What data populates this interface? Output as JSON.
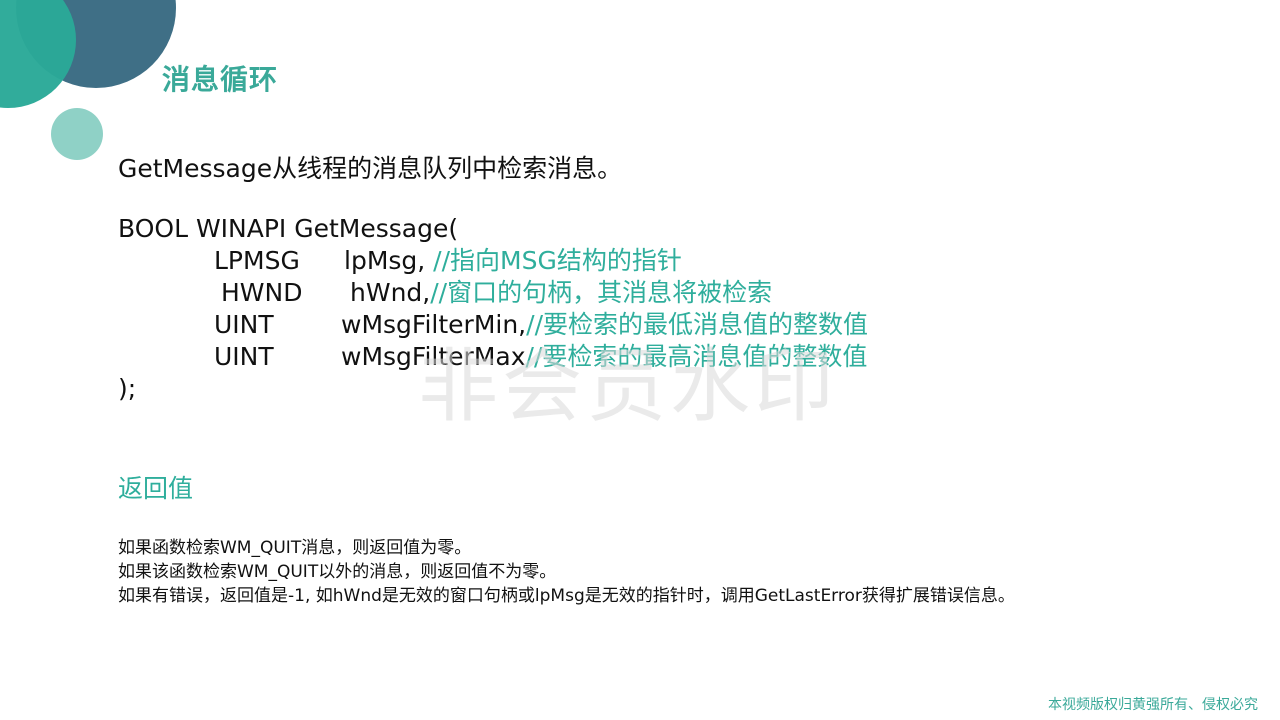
{
  "slide": {
    "title": "消息循环",
    "intro": "GetMessage从线程的消息队列中检索消息。",
    "code": {
      "signature": "BOOL WINAPI GetMessage(",
      "params": [
        {
          "type": "LPMSG",
          "name": "lpMsg,",
          "comment": " //指向MSG结构的指针"
        },
        {
          "type": "HWND",
          "name": "hWnd,",
          "comment": "//窗口的句柄，其消息将被检索"
        },
        {
          "type": "UINT",
          "name": "wMsgFilterMin,",
          "comment": "//要检索的最低消息值的整数值"
        },
        {
          "type": "UINT",
          "name": "wMsgFilterMax",
          "comment": "//要检索的最高消息值的整数值"
        }
      ],
      "closing": ");"
    },
    "return_title": "返回值",
    "return_lines": [
      "如果函数检索WM_QUIT消息，则返回值为零。",
      "如果该函数检索WM_QUIT以外的消息，则返回值不为零。",
      "如果有错误，返回值是-1, 如hWnd是无效的窗口句柄或lpMsg是无效的指针时，调用GetLastError获得扩展错误信息。"
    ],
    "watermark": "非会员水印",
    "copyright": "本视频版权归黄强所有、侵权必究"
  },
  "colors": {
    "accent": "#2fae9c",
    "dark_circle": "#3f6f86",
    "teal_circle": "#2aa998",
    "light_circle": "#8fd1c6"
  }
}
